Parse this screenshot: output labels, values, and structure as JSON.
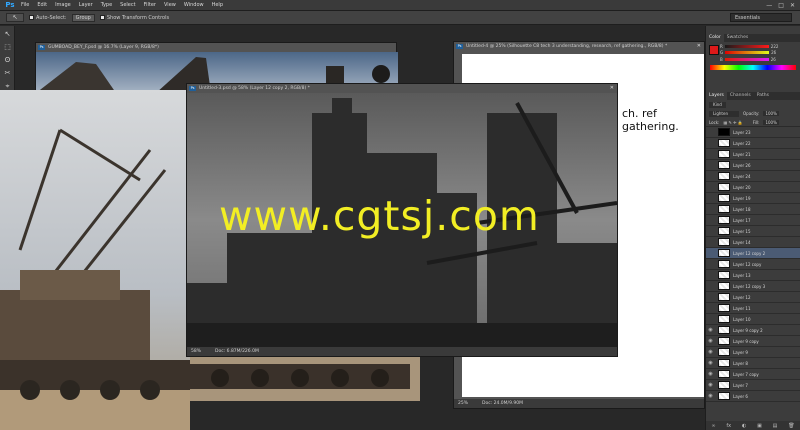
{
  "menubar": {
    "logo": "Ps",
    "items": [
      "File",
      "Edit",
      "Image",
      "Layer",
      "Type",
      "Select",
      "Filter",
      "View",
      "Window",
      "Help"
    ],
    "minimize": "—",
    "maximize": "□",
    "close": "✕"
  },
  "options": {
    "tool_glyph": "↖",
    "auto_select": "Auto-Select:",
    "auto_select_mode": "Group",
    "show_transform": "Show Transform Controls",
    "workspace": "Essentials"
  },
  "tools": [
    "↖",
    "⬚",
    "ʘ",
    "✂",
    "⌖",
    "✎",
    "▞",
    "✐",
    "◐",
    "T",
    "↗",
    "▭",
    "✋",
    "🔍"
  ],
  "doc_back": {
    "title": "GUMBOAD_BEY_F.psd @ 16.7% (Layer 9, RGB/8*)"
  },
  "doc_right": {
    "title": "Untitled-4 @ 25% (Silhouette C8 tech 3 understanding, research, ref gathering., RGB/8) *",
    "text": "ch. ref gathering.",
    "zoom": "25%",
    "doc_size": "Doc: 24.0M/9.90M"
  },
  "doc_front": {
    "title": "Untitled-3.psd @ 58% (Layer 12 copy 2, RGB/8) *",
    "zoom": "58%",
    "doc_size": "Doc: 6.87M/226.0M"
  },
  "watermark": "www.cgtsj.com",
  "color_panel": {
    "tabs": [
      "Color",
      "Swatches"
    ],
    "r": "222",
    "g": "26",
    "b": "26"
  },
  "layers_panel": {
    "tabs": [
      "Layers",
      "Channels",
      "Paths"
    ],
    "kind": "Kind",
    "blend_mode": "Lighten",
    "opacity_label": "Opacity:",
    "opacity": "100%",
    "lock_label": "Lock:",
    "fill_label": "Fill:",
    "fill": "100%",
    "layers": [
      {
        "name": "Layer 23",
        "dark": true
      },
      {
        "name": "Layer 22"
      },
      {
        "name": "Layer 21"
      },
      {
        "name": "Layer 26"
      },
      {
        "name": "Layer 24"
      },
      {
        "name": "Layer 20"
      },
      {
        "name": "Layer 19"
      },
      {
        "name": "Layer 18"
      },
      {
        "name": "Layer 17"
      },
      {
        "name": "Layer 15"
      },
      {
        "name": "Layer 14"
      },
      {
        "name": "Layer 12 copy 2",
        "selected": true
      },
      {
        "name": "Layer 12 copy"
      },
      {
        "name": "Layer 13"
      },
      {
        "name": "Layer 12 copy 3"
      },
      {
        "name": "Layer 12"
      },
      {
        "name": "Layer 11"
      },
      {
        "name": "Layer 10"
      },
      {
        "name": "Layer 9 copy 2"
      },
      {
        "name": "Layer 9 copy"
      },
      {
        "name": "Layer 9"
      },
      {
        "name": "Layer 8"
      },
      {
        "name": "Layer 7 copy"
      },
      {
        "name": "Layer 7"
      },
      {
        "name": "Layer 6"
      }
    ],
    "footer_icons": [
      "∞",
      "fx",
      "◐",
      "▣",
      "▤",
      "🗑"
    ]
  }
}
